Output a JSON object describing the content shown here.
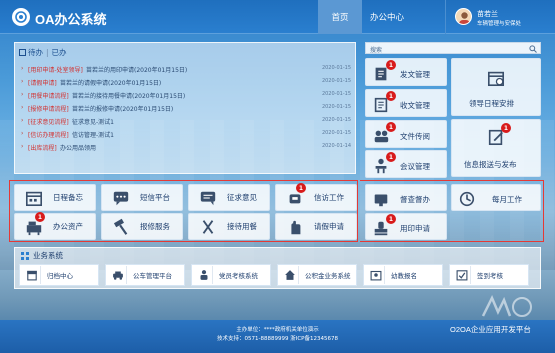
{
  "header": {
    "app_title": "OA办公系统",
    "nav": [
      {
        "label": "首页"
      },
      {
        "label": "办公中心"
      }
    ],
    "user": {
      "name": "苗若兰",
      "role": "车辆管理与安保处"
    }
  },
  "todo": {
    "tabs": [
      "待办",
      "已办"
    ],
    "items": [
      {
        "tag": "[用印申请-处室领导]",
        "title": "苗若兰的用印申请(2020年01月15日)",
        "date": "2020-01-15"
      },
      {
        "tag": "[请假申请]",
        "title": "苗若兰的请假申请(2020年01月15日)",
        "date": "2020-01-15"
      },
      {
        "tag": "[用餐申请流程]",
        "title": "苗若兰的接待用餐申请(2020年01月15日)",
        "date": "2020-01-15"
      },
      {
        "tag": "[报修申请流程]",
        "title": "苗若兰的报修申请(2020年01月15日)",
        "date": "2020-01-15"
      },
      {
        "tag": "[征求意见流程]",
        "title": "征求意见-测试1",
        "date": "2020-01-15"
      },
      {
        "tag": "[信访办理流程]",
        "title": "信访管理-测试1",
        "date": "2020-01-15"
      },
      {
        "tag": "[出库流程]",
        "title": "办公用品领用",
        "date": "2020-01-14"
      }
    ]
  },
  "tiles": [
    {
      "label": "日程备忘",
      "icon": "calendar-icon"
    },
    {
      "label": "短信平台",
      "icon": "sms-icon"
    },
    {
      "label": "征求意见",
      "icon": "chat-icon"
    },
    {
      "label": "信访工作",
      "icon": "mailbox-icon",
      "badge": "1"
    },
    {
      "label": "办公资产",
      "icon": "asset-icon",
      "badge": "1"
    },
    {
      "label": "报修服务",
      "icon": "hammer-icon"
    },
    {
      "label": "接待用餐",
      "icon": "cutlery-icon"
    },
    {
      "label": "请假申请",
      "icon": "hand-icon"
    }
  ],
  "search": {
    "placeholder": "搜索"
  },
  "right_tiles": [
    {
      "label": "发文管理",
      "icon": "outgoing-doc-icon",
      "badge": "1"
    },
    {
      "label": "收文管理",
      "icon": "incoming-doc-icon",
      "badge": "1"
    },
    {
      "label": "文件传阅",
      "icon": "circulate-icon",
      "badge": "1"
    },
    {
      "label": "会议管理",
      "icon": "meeting-icon",
      "badge": "1"
    },
    {
      "label": "领导日程安排",
      "icon": "schedule-icon"
    },
    {
      "label": "信息报送与发布",
      "icon": "publish-icon",
      "badge": "1"
    },
    {
      "label": "督查督办",
      "icon": "supervise-icon"
    },
    {
      "label": "每月工作",
      "icon": "monthly-icon"
    },
    {
      "label": "用印申请",
      "icon": "seal-icon",
      "badge": "1"
    }
  ],
  "business": {
    "title": "业务系统",
    "items": [
      {
        "label": "归档中心",
        "icon": "archive-icon"
      },
      {
        "label": "公车管理平台",
        "icon": "car-icon"
      },
      {
        "label": "党员考核系统",
        "icon": "party-icon"
      },
      {
        "label": "公积金业务系统",
        "icon": "house-icon"
      },
      {
        "label": "幼教报名",
        "icon": "school-icon"
      },
      {
        "label": "签到考核",
        "icon": "checkin-icon"
      }
    ]
  },
  "footer": {
    "line1": "主办单位：****政府机关单位演示",
    "line2": "技术支持：0571-88889999  浙ICP备12345678",
    "brand": "O2OA企业应用开发平台"
  },
  "colors": {
    "header": "#2a7fcf",
    "badge": "#d81b1b",
    "accent_red": "#e53935"
  }
}
